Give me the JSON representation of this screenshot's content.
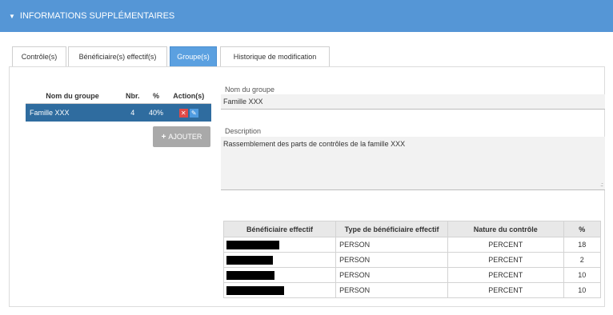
{
  "section": {
    "title": "INFORMATIONS SUPPLÉMENTAIRES"
  },
  "tabs": [
    {
      "label": "Contrôle(s)"
    },
    {
      "label": "Bénéficiaire(s) effectif(s)"
    },
    {
      "label": "Groupe(s)"
    },
    {
      "label": "Historique de modification"
    }
  ],
  "groups_table": {
    "headers": [
      "Nom du groupe",
      "Nbr.",
      "%",
      "Action(s)"
    ],
    "rows": [
      {
        "name": "Famille XXX",
        "count": "4",
        "percent": "40%"
      }
    ]
  },
  "add_button": {
    "label": "AJOUTER"
  },
  "form": {
    "group_name_label": "Nom du groupe",
    "group_name_value": "Famille XXX",
    "description_label": "Description",
    "description_value": "Rassemblement des parts de contrôles de la famille XXX"
  },
  "beneficiaries_table": {
    "headers": [
      "Bénéficiaire effectif",
      "Type de bénéficiaire effectif",
      "Nature du contrôle",
      "%"
    ],
    "rows": [
      {
        "type": "PERSON",
        "nature": "PERCENT",
        "percent": "18"
      },
      {
        "type": "PERSON",
        "nature": "PERCENT",
        "percent": "2"
      },
      {
        "type": "PERSON",
        "nature": "PERCENT",
        "percent": "10"
      },
      {
        "type": "PERSON",
        "nature": "PERCENT",
        "percent": "10"
      }
    ]
  },
  "colors": {
    "header_bar": "#5596d6",
    "active_tab": "#5ba0e0",
    "selected_row": "#2f6c9f",
    "delete_icon": "#e04a48",
    "edit_icon": "#4f9be0",
    "add_button": "#a9a9a9"
  }
}
